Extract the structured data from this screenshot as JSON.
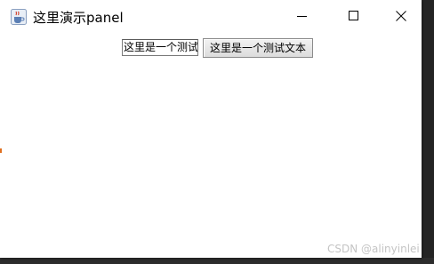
{
  "window": {
    "title": "这里演示panel",
    "icon": "java-cup-icon",
    "controls": {
      "minimize": "minimize-icon",
      "maximize": "maximize-icon",
      "close": "close-icon"
    }
  },
  "panel": {
    "text_field_value": "这里是一个测试",
    "button_label": "这里是一个测试文本"
  },
  "watermark": "CSDN @alinyinlei",
  "colors": {
    "window_bg": "#ffffff",
    "button_bg": "#e6e6e6",
    "watermark": "#c4c4c4"
  }
}
